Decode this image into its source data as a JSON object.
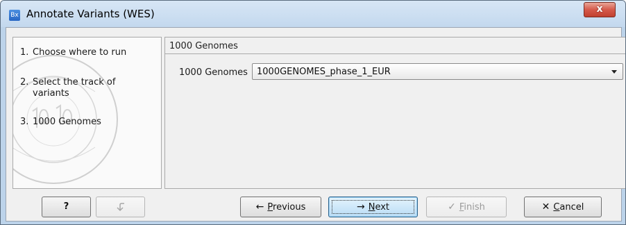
{
  "window": {
    "title": "Annotate Variants (WES)",
    "app_icon_text": "Bx",
    "close_label": "x"
  },
  "steps": [
    {
      "num": "1.",
      "label": "Choose where to run"
    },
    {
      "num": "2.",
      "label": "Select the track of variants"
    },
    {
      "num": "3.",
      "label": "1000 Genomes"
    }
  ],
  "panel": {
    "title": "1000 Genomes",
    "field_label": "1000 Genomes",
    "select_value": "1000GENOMES_phase_1_EUR"
  },
  "buttons": {
    "help": "?",
    "previous": {
      "arrow": "←",
      "pre": "",
      "mnemonic": "P",
      "post": "revious"
    },
    "next": {
      "arrow": "→",
      "pre": "",
      "mnemonic": "N",
      "post": "ext"
    },
    "finish": {
      "arrow": "✓",
      "pre": "",
      "mnemonic": "F",
      "post": "inish"
    },
    "cancel": {
      "arrow": "✕",
      "pre": "",
      "mnemonic": "C",
      "post": "ancel"
    }
  },
  "colors": {
    "titlebar": "#c9dcf0",
    "close_button": "#d5594a",
    "default_button": "#b9dcf5"
  }
}
